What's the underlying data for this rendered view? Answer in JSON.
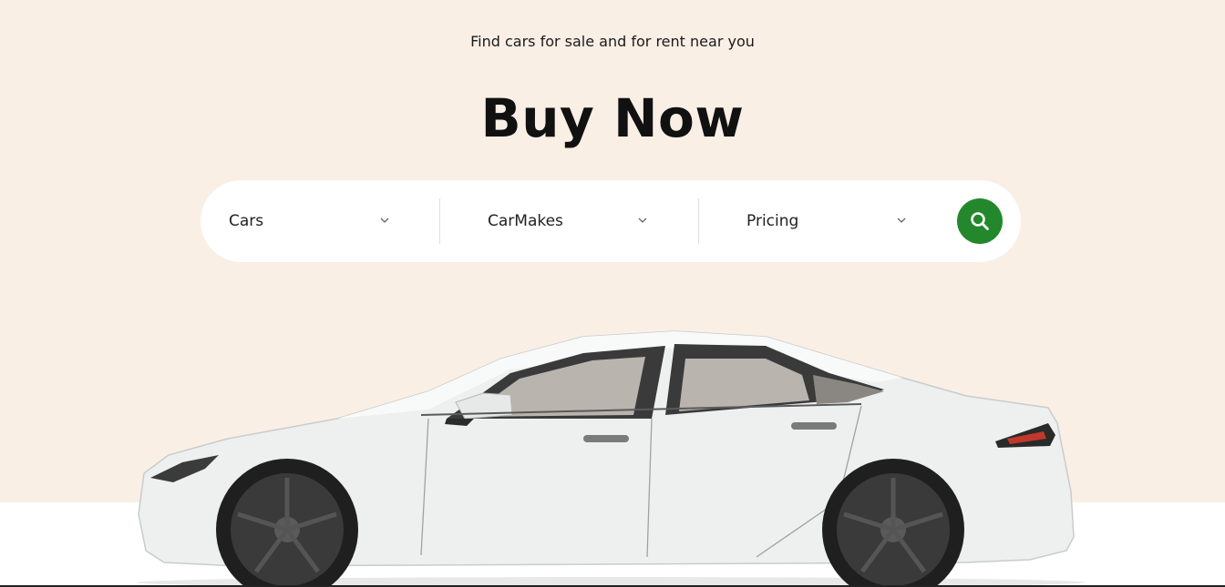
{
  "hero": {
    "subtitle": "Find cars for sale and for rent near you",
    "title": "Buy Now",
    "background_color": "#f9efe5"
  },
  "search": {
    "filters": [
      {
        "label": "Cars"
      },
      {
        "label": "CarMakes"
      },
      {
        "label": "Pricing"
      }
    ],
    "button_color": "#23882c",
    "button_icon": "search-icon"
  },
  "image": {
    "subject": "car-image",
    "color": "white"
  }
}
